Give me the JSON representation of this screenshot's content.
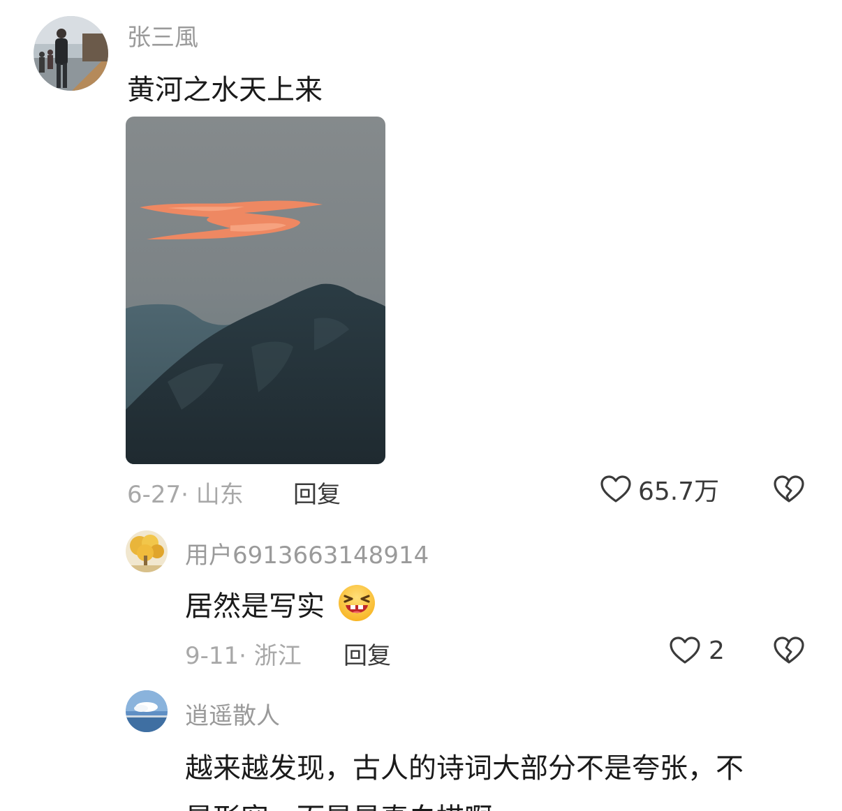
{
  "comments": [
    {
      "username": "张三風",
      "text": "黄河之水天上来",
      "date": "6-27",
      "location": "山东",
      "reply_label": "回复",
      "likes": "65.7万"
    },
    {
      "username": "用户6913663148914",
      "text": "居然是写实",
      "emoji": "laughing-face",
      "date": "9-11",
      "location": "浙江",
      "reply_label": "回复",
      "likes": "2"
    },
    {
      "username": "逍遥散人",
      "text_line1": "越来越发现，古人的诗词大部分不是夸张，不",
      "text_line2": "是形容，而是是真白描啊"
    }
  ],
  "colors": {
    "username": "#9a9a9a",
    "meta": "#a8a8a8",
    "text": "#1a1a1a",
    "river_glow": "#f08a62"
  }
}
